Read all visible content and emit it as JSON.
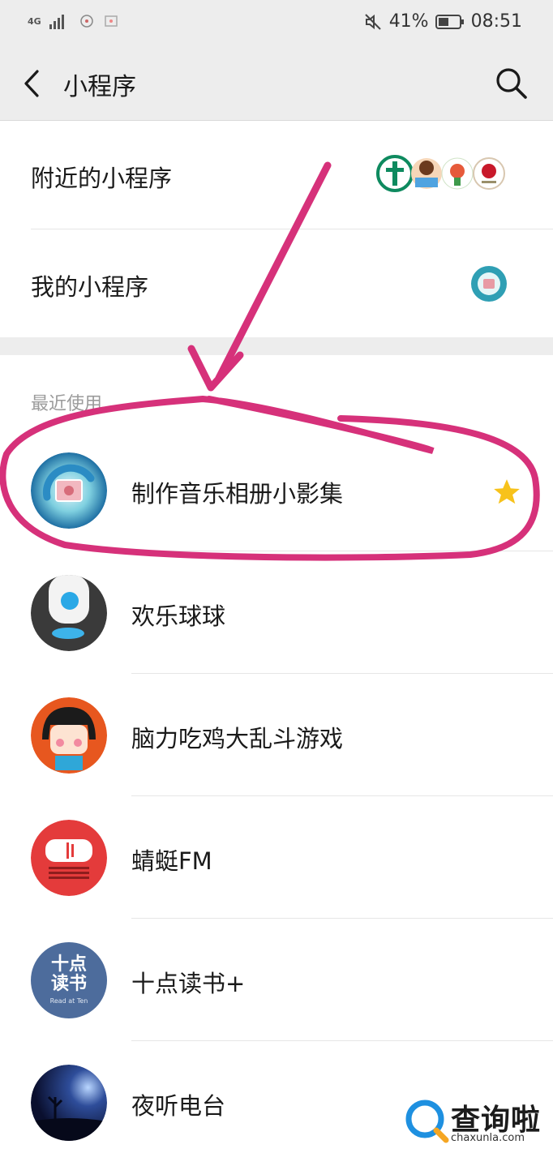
{
  "status_bar": {
    "network": "4G",
    "battery_percent": "41%",
    "time": "08:51",
    "icons": [
      "signal-icon",
      "mute-icon",
      "battery-icon"
    ]
  },
  "navbar": {
    "title": "小程序",
    "back_icon": "chevron-left-icon",
    "search_icon": "search-icon"
  },
  "menu": {
    "nearby_label": "附近的小程序",
    "mine_label": "我的小程序"
  },
  "recent": {
    "section_title": "最近使用",
    "items": [
      {
        "name": "制作音乐相册小影集",
        "starred": true
      },
      {
        "name": "欢乐球球",
        "starred": false
      },
      {
        "name": "脑力吃鸡大乱斗游戏",
        "starred": false
      },
      {
        "name": "蜻蜓FM",
        "starred": false
      },
      {
        "name": "十点读书+",
        "starred": false
      },
      {
        "name": "夜听电台",
        "starred": false
      }
    ]
  },
  "logos": {
    "shidian_top": "十点",
    "shidian_bottom": "读书",
    "shidian_en": "Read at Ten"
  },
  "watermark": {
    "text": "查询啦",
    "url": "chaxunla.com"
  },
  "colors": {
    "annotation": "#d6317a",
    "star": "#f7c21b",
    "background_gray": "#ededed"
  }
}
